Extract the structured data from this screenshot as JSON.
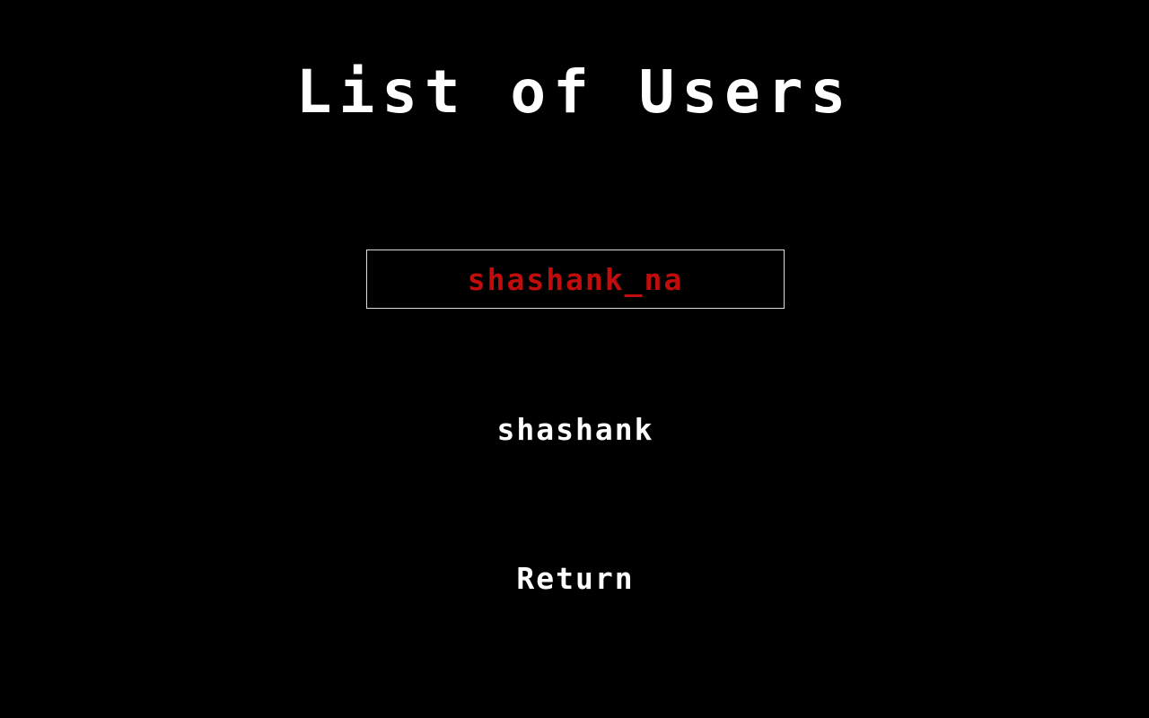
{
  "screen": {
    "title": "List of Users",
    "background_color": "#000000",
    "text_color": "#ffffff",
    "selected_color": "#c10c0c",
    "selection_border_color": "#dcdcdc"
  },
  "menu": {
    "selected_index": 0,
    "items": [
      {
        "label": "shashank_na",
        "selected": true
      },
      {
        "label": "shashank",
        "selected": false
      },
      {
        "label": "Return",
        "selected": false
      }
    ]
  }
}
